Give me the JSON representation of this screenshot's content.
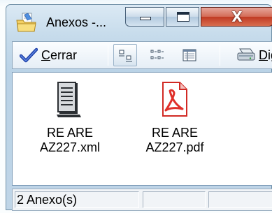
{
  "window": {
    "title": "Anexos -...",
    "icon": "folder-files-icon"
  },
  "caption_buttons": {
    "minimize": "minimize-icon",
    "maximize": "maximize-icon",
    "close_glyph": "X"
  },
  "toolbar": {
    "close_button": {
      "hotkey": "C",
      "rest": "errar",
      "icon": "checkmark-icon"
    },
    "views": [
      {
        "icon": "large-icons-view-icon",
        "active": true
      },
      {
        "icon": "small-icons-view-icon",
        "active": false
      },
      {
        "icon": "details-view-icon",
        "active": false
      }
    ],
    "digitalize_button": {
      "hotkey": "D",
      "rest": "ig",
      "icon": "scanner-icon"
    }
  },
  "files": [
    {
      "name": "RE ARE\nAZ227.xml",
      "icon": "xml-document-icon"
    },
    {
      "name": "RE ARE\nAZ227.pdf",
      "icon": "pdf-document-icon"
    }
  ],
  "statusbar": {
    "count_text": "2 Anexo(s)"
  },
  "colors": {
    "close_button": "#c03a23",
    "pdf_accent": "#e0302a"
  }
}
